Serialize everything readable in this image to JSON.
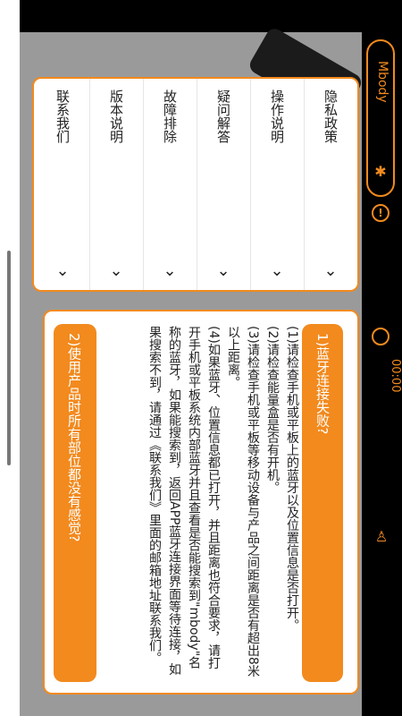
{
  "app": {
    "brand": "Mbody",
    "timer": "00:00"
  },
  "menu": {
    "items": [
      {
        "label": "隐私政策"
      },
      {
        "label": "操作说明"
      },
      {
        "label": "疑问解答"
      },
      {
        "label": "故障排除"
      },
      {
        "label": "版本说明"
      },
      {
        "label": "联系我们"
      }
    ]
  },
  "faq": {
    "q1": "1)蓝牙连接失败?",
    "a1": [
      "(1)请检查手机或平板上的蓝牙以及位置信息是否打开。",
      "(2)请检查能量盒是否有开机。",
      "(3)请检查手机或平板等移动设备与产品之间距离是否有超出8米以上距离。",
      "(4)如果蓝牙、位置信息都已打开，并且距离也符合要求，请打开手机或平板系统内部蓝牙并且查看是否能搜索到\"mbody\"名称的蓝牙，如果能搜索到，返回APP蓝牙连接界面等待连接，如果搜索不到，请通过《联系我们》里面的邮箱地址联系我们。"
    ],
    "q2": "2)使用产品时所有部位都没有感觉?"
  },
  "colors": {
    "accent": "#f28a1e",
    "gray_bg": "#9a9a9a"
  }
}
